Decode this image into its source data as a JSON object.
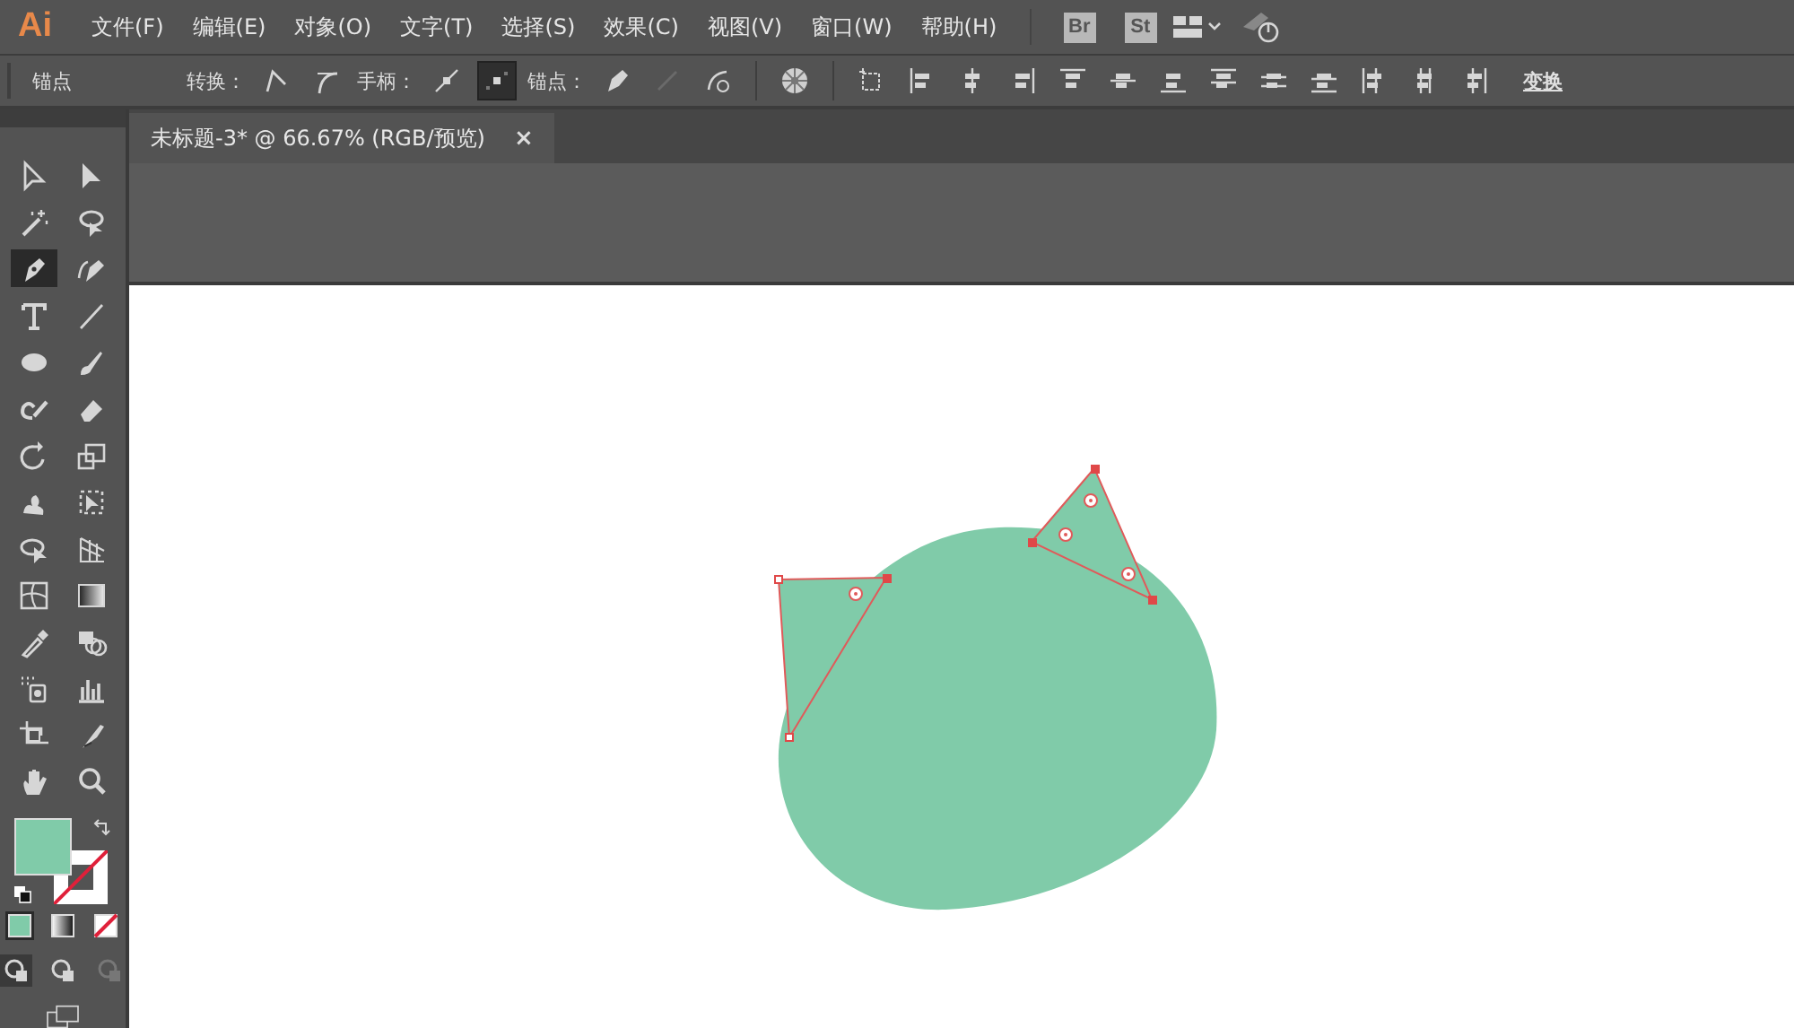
{
  "menu_bar": {
    "logo": "Ai",
    "menus": [
      "文件(F)",
      "编辑(E)",
      "对象(O)",
      "文字(T)",
      "选择(S)",
      "效果(C)",
      "视图(V)",
      "窗口(W)",
      "帮助(H)"
    ],
    "app_buttons": [
      "Br",
      "St"
    ]
  },
  "control_bar": {
    "selection_label": "锚点",
    "convert_label": "转换：",
    "handles_label": "手柄：",
    "handle_buttons": [
      {
        "selected": false
      },
      {
        "selected": true
      }
    ],
    "anchor_label": "锚点：",
    "transform_link": "变换"
  },
  "document_tab": {
    "title": "未标题-3* @ 66.67% (RGB/预览)",
    "close": "×",
    "selected": true
  },
  "tools": [
    {
      "selected": false
    },
    {
      "selected": false
    },
    {
      "selected": false
    },
    {
      "selected": false
    },
    {
      "selected": true
    },
    {
      "selected": false
    },
    {
      "selected": false
    },
    {
      "selected": false
    },
    {
      "selected": false
    },
    {
      "selected": false
    },
    {
      "selected": false
    },
    {
      "selected": false
    },
    {
      "selected": false
    },
    {
      "selected": false
    },
    {
      "selected": false
    },
    {
      "selected": false
    },
    {
      "selected": false
    },
    {
      "selected": false
    },
    {
      "selected": false
    },
    {
      "selected": false
    },
    {
      "selected": false
    },
    {
      "selected": false
    },
    {
      "selected": false
    },
    {
      "selected": false
    },
    {
      "selected": false
    },
    {
      "selected": false
    },
    {
      "selected": false
    },
    {
      "selected": false
    }
  ],
  "color_modes": [
    {
      "selected": true
    },
    {
      "selected": false
    },
    {
      "selected": false
    }
  ],
  "draw_modes": [
    {
      "selected": true
    },
    {
      "selected": false
    },
    {
      "selected": false
    }
  ]
}
